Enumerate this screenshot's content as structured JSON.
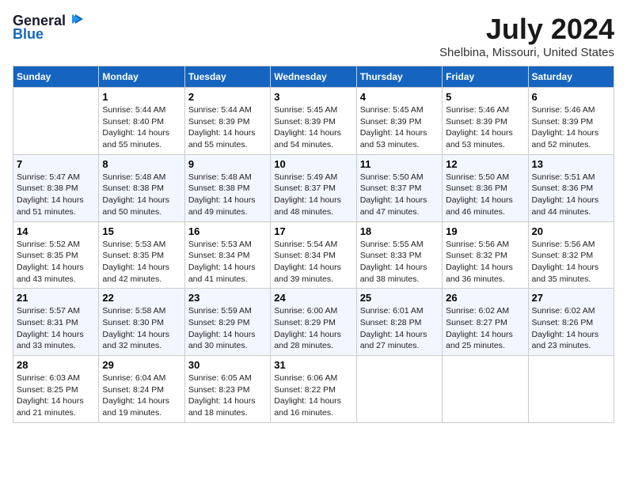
{
  "header": {
    "logo_general": "General",
    "logo_blue": "Blue",
    "month": "July 2024",
    "location": "Shelbina, Missouri, United States"
  },
  "days_of_week": [
    "Sunday",
    "Monday",
    "Tuesday",
    "Wednesday",
    "Thursday",
    "Friday",
    "Saturday"
  ],
  "weeks": [
    [
      {
        "day": "",
        "sunrise": "",
        "sunset": "",
        "daylight": ""
      },
      {
        "day": "1",
        "sunrise": "Sunrise: 5:44 AM",
        "sunset": "Sunset: 8:40 PM",
        "daylight": "Daylight: 14 hours and 55 minutes."
      },
      {
        "day": "2",
        "sunrise": "Sunrise: 5:44 AM",
        "sunset": "Sunset: 8:39 PM",
        "daylight": "Daylight: 14 hours and 55 minutes."
      },
      {
        "day": "3",
        "sunrise": "Sunrise: 5:45 AM",
        "sunset": "Sunset: 8:39 PM",
        "daylight": "Daylight: 14 hours and 54 minutes."
      },
      {
        "day": "4",
        "sunrise": "Sunrise: 5:45 AM",
        "sunset": "Sunset: 8:39 PM",
        "daylight": "Daylight: 14 hours and 53 minutes."
      },
      {
        "day": "5",
        "sunrise": "Sunrise: 5:46 AM",
        "sunset": "Sunset: 8:39 PM",
        "daylight": "Daylight: 14 hours and 53 minutes."
      },
      {
        "day": "6",
        "sunrise": "Sunrise: 5:46 AM",
        "sunset": "Sunset: 8:39 PM",
        "daylight": "Daylight: 14 hours and 52 minutes."
      }
    ],
    [
      {
        "day": "7",
        "sunrise": "Sunrise: 5:47 AM",
        "sunset": "Sunset: 8:38 PM",
        "daylight": "Daylight: 14 hours and 51 minutes."
      },
      {
        "day": "8",
        "sunrise": "Sunrise: 5:48 AM",
        "sunset": "Sunset: 8:38 PM",
        "daylight": "Daylight: 14 hours and 50 minutes."
      },
      {
        "day": "9",
        "sunrise": "Sunrise: 5:48 AM",
        "sunset": "Sunset: 8:38 PM",
        "daylight": "Daylight: 14 hours and 49 minutes."
      },
      {
        "day": "10",
        "sunrise": "Sunrise: 5:49 AM",
        "sunset": "Sunset: 8:37 PM",
        "daylight": "Daylight: 14 hours and 48 minutes."
      },
      {
        "day": "11",
        "sunrise": "Sunrise: 5:50 AM",
        "sunset": "Sunset: 8:37 PM",
        "daylight": "Daylight: 14 hours and 47 minutes."
      },
      {
        "day": "12",
        "sunrise": "Sunrise: 5:50 AM",
        "sunset": "Sunset: 8:36 PM",
        "daylight": "Daylight: 14 hours and 46 minutes."
      },
      {
        "day": "13",
        "sunrise": "Sunrise: 5:51 AM",
        "sunset": "Sunset: 8:36 PM",
        "daylight": "Daylight: 14 hours and 44 minutes."
      }
    ],
    [
      {
        "day": "14",
        "sunrise": "Sunrise: 5:52 AM",
        "sunset": "Sunset: 8:35 PM",
        "daylight": "Daylight: 14 hours and 43 minutes."
      },
      {
        "day": "15",
        "sunrise": "Sunrise: 5:53 AM",
        "sunset": "Sunset: 8:35 PM",
        "daylight": "Daylight: 14 hours and 42 minutes."
      },
      {
        "day": "16",
        "sunrise": "Sunrise: 5:53 AM",
        "sunset": "Sunset: 8:34 PM",
        "daylight": "Daylight: 14 hours and 41 minutes."
      },
      {
        "day": "17",
        "sunrise": "Sunrise: 5:54 AM",
        "sunset": "Sunset: 8:34 PM",
        "daylight": "Daylight: 14 hours and 39 minutes."
      },
      {
        "day": "18",
        "sunrise": "Sunrise: 5:55 AM",
        "sunset": "Sunset: 8:33 PM",
        "daylight": "Daylight: 14 hours and 38 minutes."
      },
      {
        "day": "19",
        "sunrise": "Sunrise: 5:56 AM",
        "sunset": "Sunset: 8:32 PM",
        "daylight": "Daylight: 14 hours and 36 minutes."
      },
      {
        "day": "20",
        "sunrise": "Sunrise: 5:56 AM",
        "sunset": "Sunset: 8:32 PM",
        "daylight": "Daylight: 14 hours and 35 minutes."
      }
    ],
    [
      {
        "day": "21",
        "sunrise": "Sunrise: 5:57 AM",
        "sunset": "Sunset: 8:31 PM",
        "daylight": "Daylight: 14 hours and 33 minutes."
      },
      {
        "day": "22",
        "sunrise": "Sunrise: 5:58 AM",
        "sunset": "Sunset: 8:30 PM",
        "daylight": "Daylight: 14 hours and 32 minutes."
      },
      {
        "day": "23",
        "sunrise": "Sunrise: 5:59 AM",
        "sunset": "Sunset: 8:29 PM",
        "daylight": "Daylight: 14 hours and 30 minutes."
      },
      {
        "day": "24",
        "sunrise": "Sunrise: 6:00 AM",
        "sunset": "Sunset: 8:29 PM",
        "daylight": "Daylight: 14 hours and 28 minutes."
      },
      {
        "day": "25",
        "sunrise": "Sunrise: 6:01 AM",
        "sunset": "Sunset: 8:28 PM",
        "daylight": "Daylight: 14 hours and 27 minutes."
      },
      {
        "day": "26",
        "sunrise": "Sunrise: 6:02 AM",
        "sunset": "Sunset: 8:27 PM",
        "daylight": "Daylight: 14 hours and 25 minutes."
      },
      {
        "day": "27",
        "sunrise": "Sunrise: 6:02 AM",
        "sunset": "Sunset: 8:26 PM",
        "daylight": "Daylight: 14 hours and 23 minutes."
      }
    ],
    [
      {
        "day": "28",
        "sunrise": "Sunrise: 6:03 AM",
        "sunset": "Sunset: 8:25 PM",
        "daylight": "Daylight: 14 hours and 21 minutes."
      },
      {
        "day": "29",
        "sunrise": "Sunrise: 6:04 AM",
        "sunset": "Sunset: 8:24 PM",
        "daylight": "Daylight: 14 hours and 19 minutes."
      },
      {
        "day": "30",
        "sunrise": "Sunrise: 6:05 AM",
        "sunset": "Sunset: 8:23 PM",
        "daylight": "Daylight: 14 hours and 18 minutes."
      },
      {
        "day": "31",
        "sunrise": "Sunrise: 6:06 AM",
        "sunset": "Sunset: 8:22 PM",
        "daylight": "Daylight: 14 hours and 16 minutes."
      },
      {
        "day": "",
        "sunrise": "",
        "sunset": "",
        "daylight": ""
      },
      {
        "day": "",
        "sunrise": "",
        "sunset": "",
        "daylight": ""
      },
      {
        "day": "",
        "sunrise": "",
        "sunset": "",
        "daylight": ""
      }
    ]
  ]
}
